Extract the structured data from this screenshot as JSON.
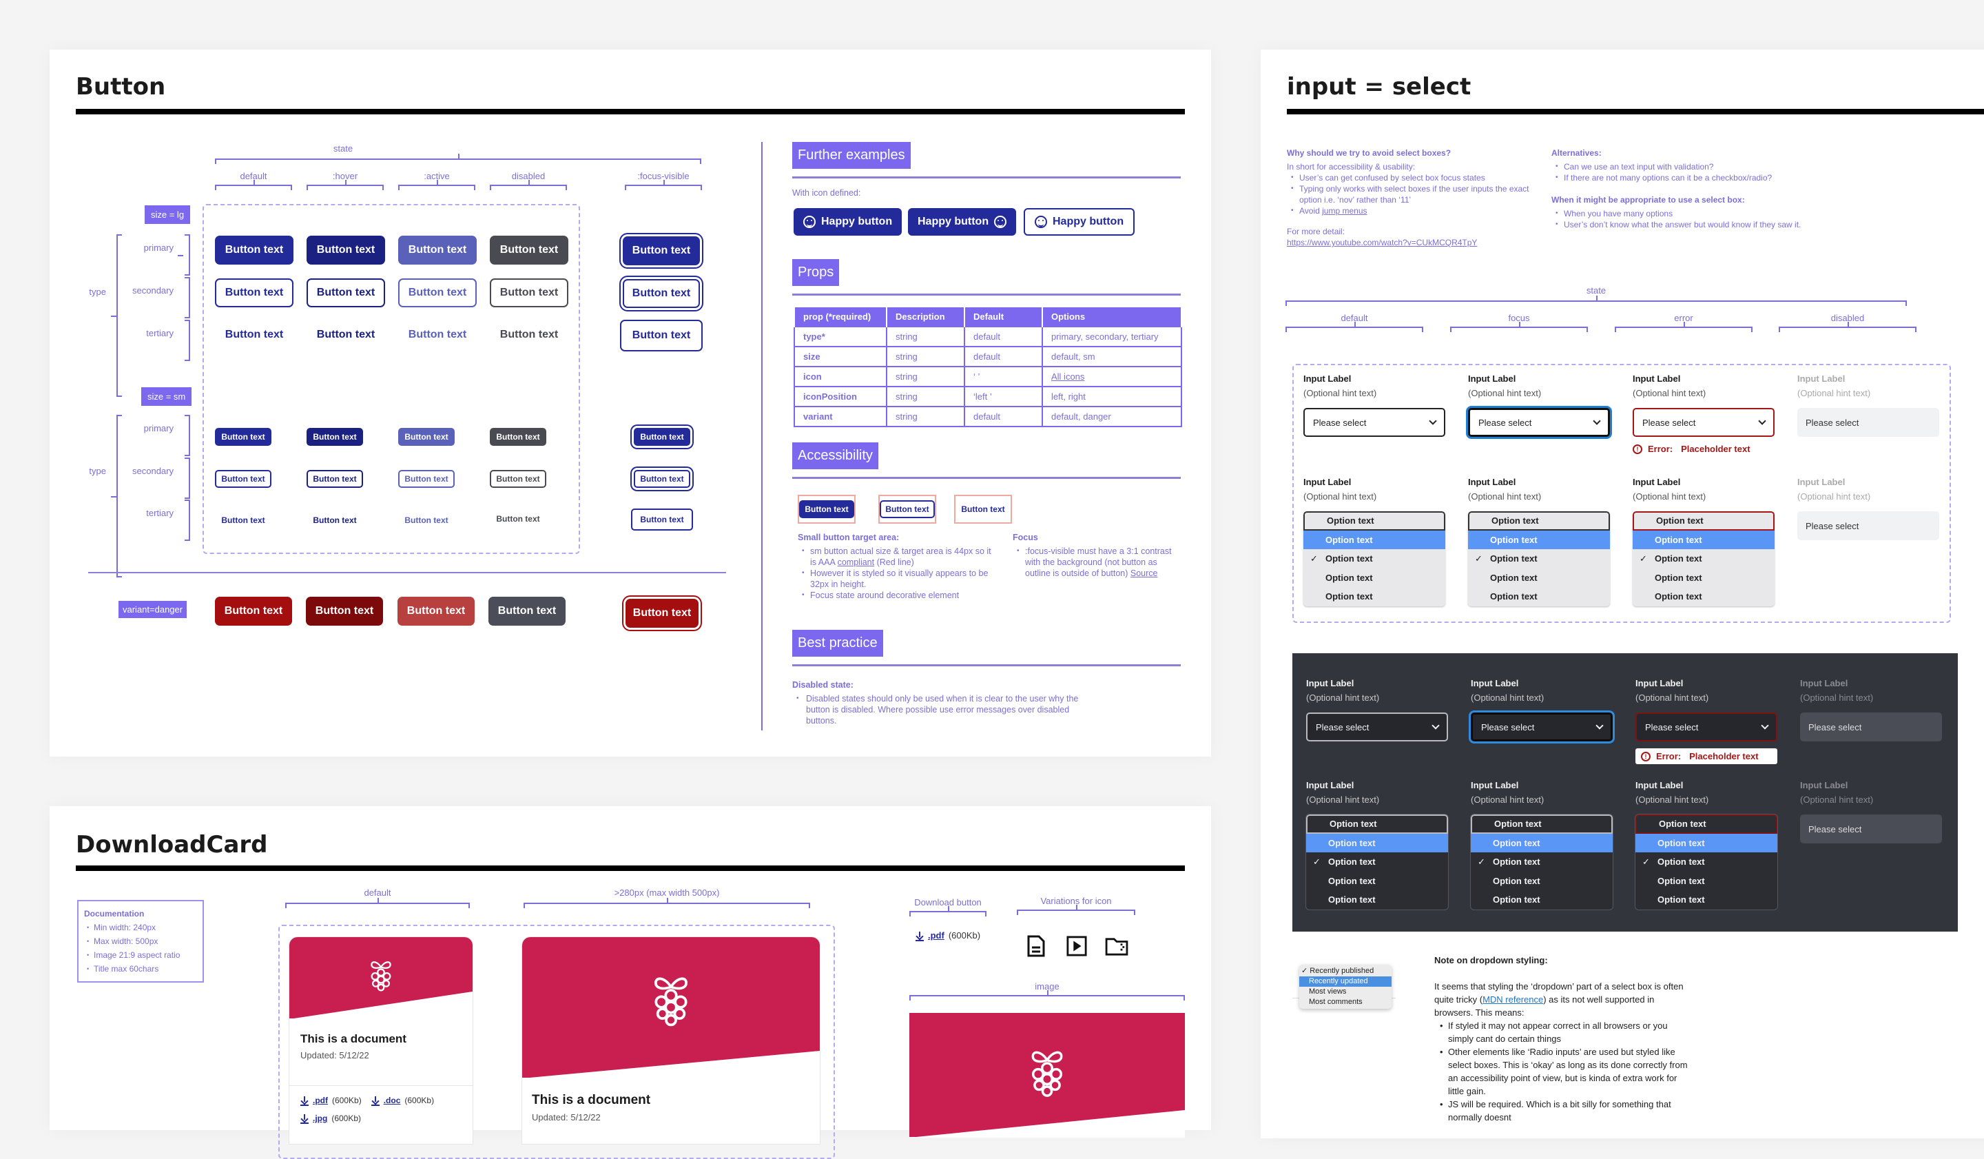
{
  "button_panel": {
    "title": "Button",
    "state_label": "state",
    "states": [
      "default",
      ":hover",
      ":active",
      "disabled",
      ":focus-visible"
    ],
    "size_lg_tag": "size = lg",
    "size_sm_tag": "size = sm",
    "type_label": "type",
    "types": [
      "primary",
      "secondary",
      "tertiary"
    ],
    "button_label": "Button text",
    "variant_danger_tag": "variant=danger",
    "further_examples": {
      "heading": "Further examples",
      "caption": "With icon defined:",
      "buttons": [
        "Happy button",
        "Happy button",
        "Happy button"
      ]
    },
    "props": {
      "heading": "Props",
      "columns": [
        "prop  (*required)",
        "Description",
        "Default",
        "Options"
      ],
      "rows": [
        [
          "type*",
          "string",
          "default",
          "primary, secondary, tertiary"
        ],
        [
          "size",
          "string",
          "default",
          "default, sm"
        ],
        [
          "icon",
          "string",
          "‘ ’",
          "All icons"
        ],
        [
          "iconPosition",
          "string",
          "‘left ’",
          "left, right"
        ],
        [
          "variant",
          "string",
          "default",
          "default, danger"
        ]
      ]
    },
    "accessibility": {
      "heading": "Accessibility",
      "small_target_title": "Small button target area:",
      "small_target_items": [
        "sm button actual size & target area is 44px so it is AAA ",
        "However it is styled so it visually appears to be 32px in height.",
        "Focus state around decorative element"
      ],
      "compliant_link": "compliant",
      "red_line": " (Red line)",
      "focus_title": "Focus",
      "focus_item": ":focus-visible must have a 3:1 contrast with the background (not button as outline is outside of button) ",
      "source_link": "Source"
    },
    "best_practice": {
      "heading": "Best practice",
      "disabled_title": "Disabled state:",
      "disabled_item": "Disabled states should only be used when it is clear to the user why the button is disabled. Where possible use error messages over disabled buttons."
    }
  },
  "download_panel": {
    "title": "DownloadCard",
    "documentation": {
      "title": "Documentation",
      "items": [
        "Min width: 240px",
        "Max width: 500px",
        "Image 21:9 aspect ratio",
        "Title max 60chars"
      ]
    },
    "labels": {
      "default": "default",
      "wide": ">280px (max width 500px)",
      "download_button": "Download button",
      "icon_variations": "Variations for icon",
      "image": "image"
    },
    "card": {
      "title": "This is a document",
      "updated": "Updated: 5/12/22",
      "downloads": [
        {
          "ext": ".pdf",
          "size": "(600Kb)"
        },
        {
          "ext": ".doc",
          "size": "(600Kb)"
        },
        {
          "ext": ".jpg",
          "size": "(600Kb)"
        }
      ]
    },
    "brand_color": "#c81f50"
  },
  "select_panel": {
    "title": "input = select",
    "why": {
      "title": "Why should we try to avoid select boxes?",
      "intro": "In short for accessibility & usability:",
      "items": [
        "User’s can get confused by select box focus states",
        "Typing only works with select boxes if the user inputs the exact option i.e. ‘nov’ rather than ‘11’",
        "Avoid "
      ],
      "jump_link": "jump menus",
      "more_detail": "For more detail:",
      "url": "https://www.youtube.com/watch?v=CUkMCQR4TpY"
    },
    "alternatives": {
      "title": "Alternatives:",
      "items": [
        "Can we use an text input with validation?",
        "If there are not many options can it be a checkbox/radio?"
      ]
    },
    "appropriate": {
      "title": "When it might be appropriate to use a select box:",
      "items": [
        "When you have many options",
        "User’s don’t know what the answer but would know if they saw it."
      ]
    },
    "state_label": "state",
    "states": [
      "default",
      "focus",
      "error",
      "disabled"
    ],
    "input_label": "Input Label",
    "hint": "(Optional hint text)",
    "placeholder": "Please select",
    "error_prefix": "Error:",
    "error_text": "Placeholder text",
    "option": "Option text",
    "native_dropdown": [
      "Recently published",
      "Recently updated",
      "Most views",
      "Most comments"
    ],
    "note": {
      "title": "Note on dropdown styling:",
      "para_a": "It seems that styling the ‘dropdown’ part of a select box is often quite tricky (",
      "mdn_link": "MDN reference",
      "para_b": ") as its not well supported in browsers. This means:",
      "items": [
        "If styled it may not appear correct in all browsers or you simply cant do certain things",
        "Other elements like ‘Radio inputs’ are used but styled like select boxes. This is ‘okay’ as long as its done correctly from an accessibility point of view, but is kinda of extra work for little gain.",
        "JS will be required. Which is a bit silly for something that normally doesnt"
      ]
    }
  }
}
